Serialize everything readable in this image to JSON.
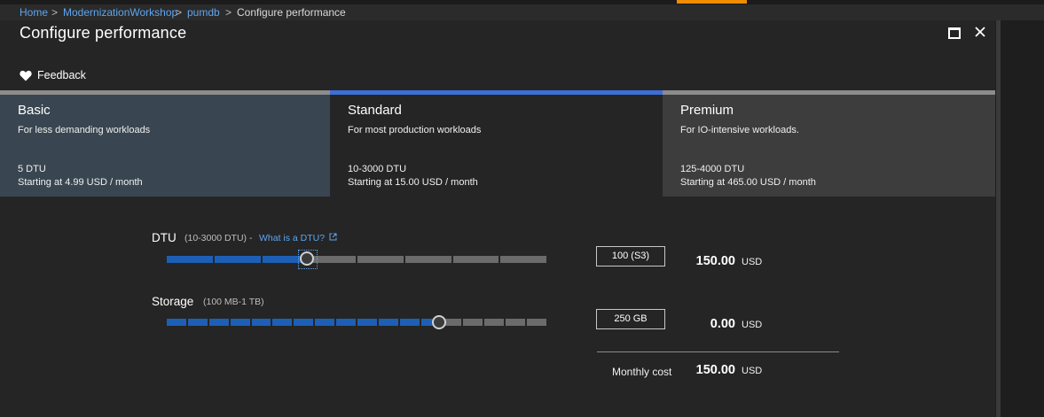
{
  "breadcrumb": {
    "items": [
      "Home",
      "ModernizationWorkshop",
      "pumdb"
    ],
    "current": "Configure performance",
    "separator": ">"
  },
  "blade": {
    "title": "Configure performance",
    "feedback_label": "Feedback"
  },
  "tiers": [
    {
      "name": "Basic",
      "description": "For less demanding workloads",
      "range": "5 DTU",
      "price": "Starting at 4.99 USD / month",
      "selected": false
    },
    {
      "name": "Standard",
      "description": "For most production workloads",
      "range": "10-3000 DTU",
      "price": "Starting at 15.00 USD / month",
      "selected": true
    },
    {
      "name": "Premium",
      "description": "For IO-intensive workloads.",
      "range": "125-4000 DTU",
      "price": "Starting at 465.00 USD / month",
      "selected": false
    }
  ],
  "dtu": {
    "label": "DTU",
    "range": "(10-3000 DTU) -",
    "link": "What is a DTU?",
    "value": "100 (S3)",
    "cost": "150.00",
    "unit": "USD",
    "segments_total": 8,
    "segments_filled": 3
  },
  "storage": {
    "label": "Storage",
    "range": "(100 MB-1 TB)",
    "value": "250 GB",
    "cost": "0.00",
    "unit": "USD",
    "segments_total": 18,
    "segments_filled": 13
  },
  "monthly": {
    "label": "Monthly cost",
    "cost": "150.00",
    "unit": "USD"
  },
  "colors": {
    "accent_orange": "#f08c00",
    "link_blue": "#5ea5f0",
    "slider_filled": "#1d5fb4",
    "slider_empty": "#6b6b6b",
    "selected_tier_bar": "#3c6fd6"
  }
}
